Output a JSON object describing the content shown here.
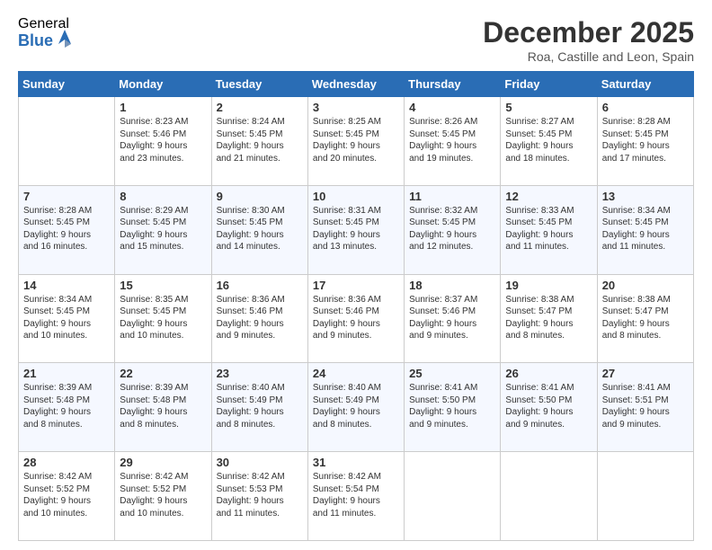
{
  "logo": {
    "general": "General",
    "blue": "Blue"
  },
  "title": "December 2025",
  "subtitle": "Roa, Castille and Leon, Spain",
  "days": [
    "Sunday",
    "Monday",
    "Tuesday",
    "Wednesday",
    "Thursday",
    "Friday",
    "Saturday"
  ],
  "weeks": [
    [
      {
        "num": "",
        "lines": []
      },
      {
        "num": "1",
        "lines": [
          "Sunrise: 8:23 AM",
          "Sunset: 5:46 PM",
          "Daylight: 9 hours",
          "and 23 minutes."
        ]
      },
      {
        "num": "2",
        "lines": [
          "Sunrise: 8:24 AM",
          "Sunset: 5:45 PM",
          "Daylight: 9 hours",
          "and 21 minutes."
        ]
      },
      {
        "num": "3",
        "lines": [
          "Sunrise: 8:25 AM",
          "Sunset: 5:45 PM",
          "Daylight: 9 hours",
          "and 20 minutes."
        ]
      },
      {
        "num": "4",
        "lines": [
          "Sunrise: 8:26 AM",
          "Sunset: 5:45 PM",
          "Daylight: 9 hours",
          "and 19 minutes."
        ]
      },
      {
        "num": "5",
        "lines": [
          "Sunrise: 8:27 AM",
          "Sunset: 5:45 PM",
          "Daylight: 9 hours",
          "and 18 minutes."
        ]
      },
      {
        "num": "6",
        "lines": [
          "Sunrise: 8:28 AM",
          "Sunset: 5:45 PM",
          "Daylight: 9 hours",
          "and 17 minutes."
        ]
      }
    ],
    [
      {
        "num": "7",
        "lines": [
          "Sunrise: 8:28 AM",
          "Sunset: 5:45 PM",
          "Daylight: 9 hours",
          "and 16 minutes."
        ]
      },
      {
        "num": "8",
        "lines": [
          "Sunrise: 8:29 AM",
          "Sunset: 5:45 PM",
          "Daylight: 9 hours",
          "and 15 minutes."
        ]
      },
      {
        "num": "9",
        "lines": [
          "Sunrise: 8:30 AM",
          "Sunset: 5:45 PM",
          "Daylight: 9 hours",
          "and 14 minutes."
        ]
      },
      {
        "num": "10",
        "lines": [
          "Sunrise: 8:31 AM",
          "Sunset: 5:45 PM",
          "Daylight: 9 hours",
          "and 13 minutes."
        ]
      },
      {
        "num": "11",
        "lines": [
          "Sunrise: 8:32 AM",
          "Sunset: 5:45 PM",
          "Daylight: 9 hours",
          "and 12 minutes."
        ]
      },
      {
        "num": "12",
        "lines": [
          "Sunrise: 8:33 AM",
          "Sunset: 5:45 PM",
          "Daylight: 9 hours",
          "and 11 minutes."
        ]
      },
      {
        "num": "13",
        "lines": [
          "Sunrise: 8:34 AM",
          "Sunset: 5:45 PM",
          "Daylight: 9 hours",
          "and 11 minutes."
        ]
      }
    ],
    [
      {
        "num": "14",
        "lines": [
          "Sunrise: 8:34 AM",
          "Sunset: 5:45 PM",
          "Daylight: 9 hours",
          "and 10 minutes."
        ]
      },
      {
        "num": "15",
        "lines": [
          "Sunrise: 8:35 AM",
          "Sunset: 5:45 PM",
          "Daylight: 9 hours",
          "and 10 minutes."
        ]
      },
      {
        "num": "16",
        "lines": [
          "Sunrise: 8:36 AM",
          "Sunset: 5:46 PM",
          "Daylight: 9 hours",
          "and 9 minutes."
        ]
      },
      {
        "num": "17",
        "lines": [
          "Sunrise: 8:36 AM",
          "Sunset: 5:46 PM",
          "Daylight: 9 hours",
          "and 9 minutes."
        ]
      },
      {
        "num": "18",
        "lines": [
          "Sunrise: 8:37 AM",
          "Sunset: 5:46 PM",
          "Daylight: 9 hours",
          "and 9 minutes."
        ]
      },
      {
        "num": "19",
        "lines": [
          "Sunrise: 8:38 AM",
          "Sunset: 5:47 PM",
          "Daylight: 9 hours",
          "and 8 minutes."
        ]
      },
      {
        "num": "20",
        "lines": [
          "Sunrise: 8:38 AM",
          "Sunset: 5:47 PM",
          "Daylight: 9 hours",
          "and 8 minutes."
        ]
      }
    ],
    [
      {
        "num": "21",
        "lines": [
          "Sunrise: 8:39 AM",
          "Sunset: 5:48 PM",
          "Daylight: 9 hours",
          "and 8 minutes."
        ]
      },
      {
        "num": "22",
        "lines": [
          "Sunrise: 8:39 AM",
          "Sunset: 5:48 PM",
          "Daylight: 9 hours",
          "and 8 minutes."
        ]
      },
      {
        "num": "23",
        "lines": [
          "Sunrise: 8:40 AM",
          "Sunset: 5:49 PM",
          "Daylight: 9 hours",
          "and 8 minutes."
        ]
      },
      {
        "num": "24",
        "lines": [
          "Sunrise: 8:40 AM",
          "Sunset: 5:49 PM",
          "Daylight: 9 hours",
          "and 8 minutes."
        ]
      },
      {
        "num": "25",
        "lines": [
          "Sunrise: 8:41 AM",
          "Sunset: 5:50 PM",
          "Daylight: 9 hours",
          "and 9 minutes."
        ]
      },
      {
        "num": "26",
        "lines": [
          "Sunrise: 8:41 AM",
          "Sunset: 5:50 PM",
          "Daylight: 9 hours",
          "and 9 minutes."
        ]
      },
      {
        "num": "27",
        "lines": [
          "Sunrise: 8:41 AM",
          "Sunset: 5:51 PM",
          "Daylight: 9 hours",
          "and 9 minutes."
        ]
      }
    ],
    [
      {
        "num": "28",
        "lines": [
          "Sunrise: 8:42 AM",
          "Sunset: 5:52 PM",
          "Daylight: 9 hours",
          "and 10 minutes."
        ]
      },
      {
        "num": "29",
        "lines": [
          "Sunrise: 8:42 AM",
          "Sunset: 5:52 PM",
          "Daylight: 9 hours",
          "and 10 minutes."
        ]
      },
      {
        "num": "30",
        "lines": [
          "Sunrise: 8:42 AM",
          "Sunset: 5:53 PM",
          "Daylight: 9 hours",
          "and 11 minutes."
        ]
      },
      {
        "num": "31",
        "lines": [
          "Sunrise: 8:42 AM",
          "Sunset: 5:54 PM",
          "Daylight: 9 hours",
          "and 11 minutes."
        ]
      },
      {
        "num": "",
        "lines": []
      },
      {
        "num": "",
        "lines": []
      },
      {
        "num": "",
        "lines": []
      }
    ]
  ]
}
